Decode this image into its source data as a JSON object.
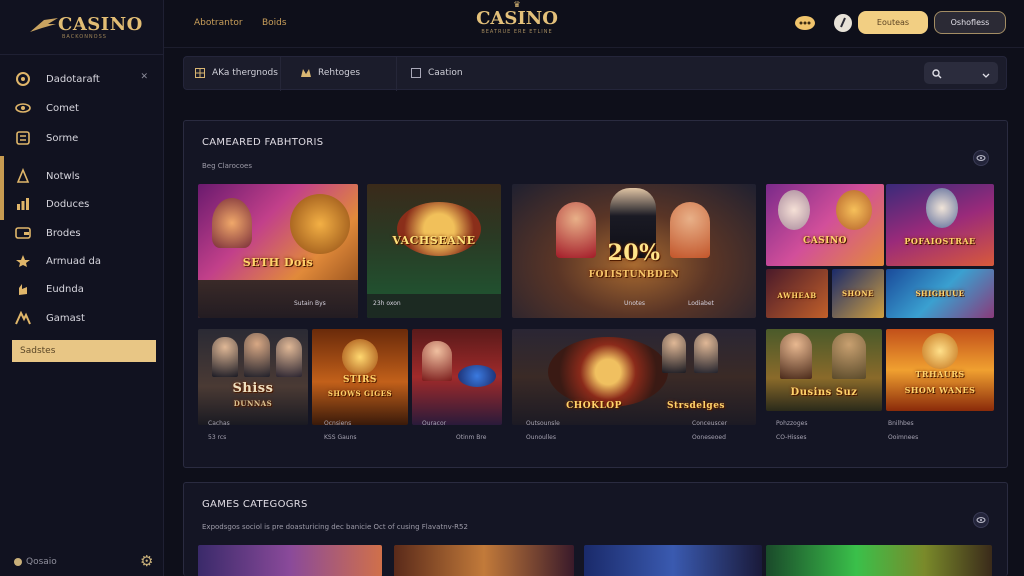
{
  "sidebar": {
    "logo_text": "CASINO",
    "logo_sub": "BACKONNOSS",
    "items": [
      {
        "label": "Dadotaraft",
        "icon": "spiral-icon"
      },
      {
        "label": "Comet",
        "icon": "eye-icon"
      },
      {
        "label": "Sorme",
        "icon": "coin-stack-icon"
      },
      {
        "label": "Notwls",
        "icon": "chips-icon"
      },
      {
        "label": "Doduces",
        "icon": "chart-icon"
      },
      {
        "label": "Brodes",
        "icon": "wallet-icon"
      },
      {
        "label": "Armuad da",
        "icon": "star-icon"
      },
      {
        "label": "Eudnda",
        "icon": "hand-icon"
      },
      {
        "label": "Gamast",
        "icon": "gamepad-icon"
      }
    ],
    "active_item": "Sadstes",
    "footer_label": "Qosaio"
  },
  "topbar": {
    "link1": "Abotrantor",
    "link2": "Boids",
    "center_logo": "CASINO",
    "center_sub": "BEATRUE ERE ETLINE",
    "btn_primary": "Eouteas",
    "btn_secondary": "Oshofless"
  },
  "filters": {
    "tab1": "AKa thergnods",
    "tab2": "Rehtoges",
    "tab3": "Caation"
  },
  "featured": {
    "title": "CAMEARED FABHTORIS",
    "subtitle": "Beg Clarocoes",
    "tiles": [
      {
        "title": "SETH Dois",
        "meta": "Sutain Bys"
      },
      {
        "title": "VACHSEANE",
        "meta": "23h oxon"
      },
      {
        "title": "20%",
        "subtitle": "FOLISTUNBDEN",
        "meta_left": "Unotes",
        "meta_right": "Lodiabet"
      },
      {
        "title": "CASINO",
        "meta": ""
      },
      {
        "title": "POFAIOSTRAE",
        "meta": ""
      },
      {
        "title": "AWHEAB",
        "meta": ""
      },
      {
        "title": "SHONE",
        "meta": ""
      },
      {
        "title": "SHIGHUUE",
        "meta": ""
      },
      {
        "title": "Shiss",
        "subtitle": "DUNNAS",
        "meta": "Cachas",
        "meta2": "53 rcs"
      },
      {
        "title": "STIRS",
        "subtitle": "SHOWS GIGES",
        "meta": "Ocnsiens",
        "meta2": "KSS Gauns"
      },
      {
        "title": "",
        "meta": "Ouracor",
        "meta2": "Otinm Bre"
      },
      {
        "title": "CHOKLOP",
        "subtitle": "Strsdelges",
        "meta": "Outsounsle",
        "meta2": "Ounoulles"
      },
      {
        "title": "",
        "meta": "Conceuscer",
        "meta2": "Ooneseoed"
      },
      {
        "title": "Dusins Suz",
        "meta": "Pohzzoges",
        "meta2": "CO-Hisses"
      },
      {
        "title": "TRHAURS",
        "subtitle": "SHOM WANES",
        "meta": "Bnilhbes",
        "meta2": "Ooimnees"
      }
    ]
  },
  "categories": {
    "title": "GAMES CATEGOGRS",
    "subtitle": "Expodsgos sociol is pre doasturicing dec banicie Oct of cusing Flavatnv-R52"
  },
  "colors": {
    "accent_gold": "#e8c685",
    "background": "#0e0f1a",
    "panel": "#141524"
  }
}
